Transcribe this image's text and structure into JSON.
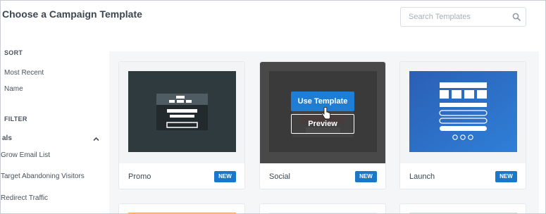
{
  "page": {
    "title": "Choose a Campaign Template"
  },
  "search": {
    "placeholder": "Search Templates",
    "icon": "search-icon"
  },
  "sidebar": {
    "sort_heading": "SORT",
    "sort_items": [
      "Most Recent",
      "Name"
    ],
    "filter_heading": "FILTER",
    "group": {
      "label": "als",
      "expanded": true
    },
    "filter_items": [
      "Grow Email List",
      "Target Abandoning Visitors",
      "Redirect Traffic"
    ]
  },
  "templates": [
    {
      "name": "Promo",
      "badge": "NEW",
      "thumb_color": "#2f3a3f"
    },
    {
      "name": "Social",
      "badge": "NEW",
      "thumb_color": "#383838",
      "hovered": true
    },
    {
      "name": "Launch",
      "badge": "NEW",
      "thumb_color": "#2566b8"
    }
  ],
  "hover_actions": {
    "use_label": "Use Template",
    "preview_label": "Preview"
  },
  "peek_colors": [
    "#e8a76d",
    "#eceef1",
    "#cfe3d4"
  ],
  "colors": {
    "accent": "#1b78c8",
    "button": "#1e7ed6"
  }
}
